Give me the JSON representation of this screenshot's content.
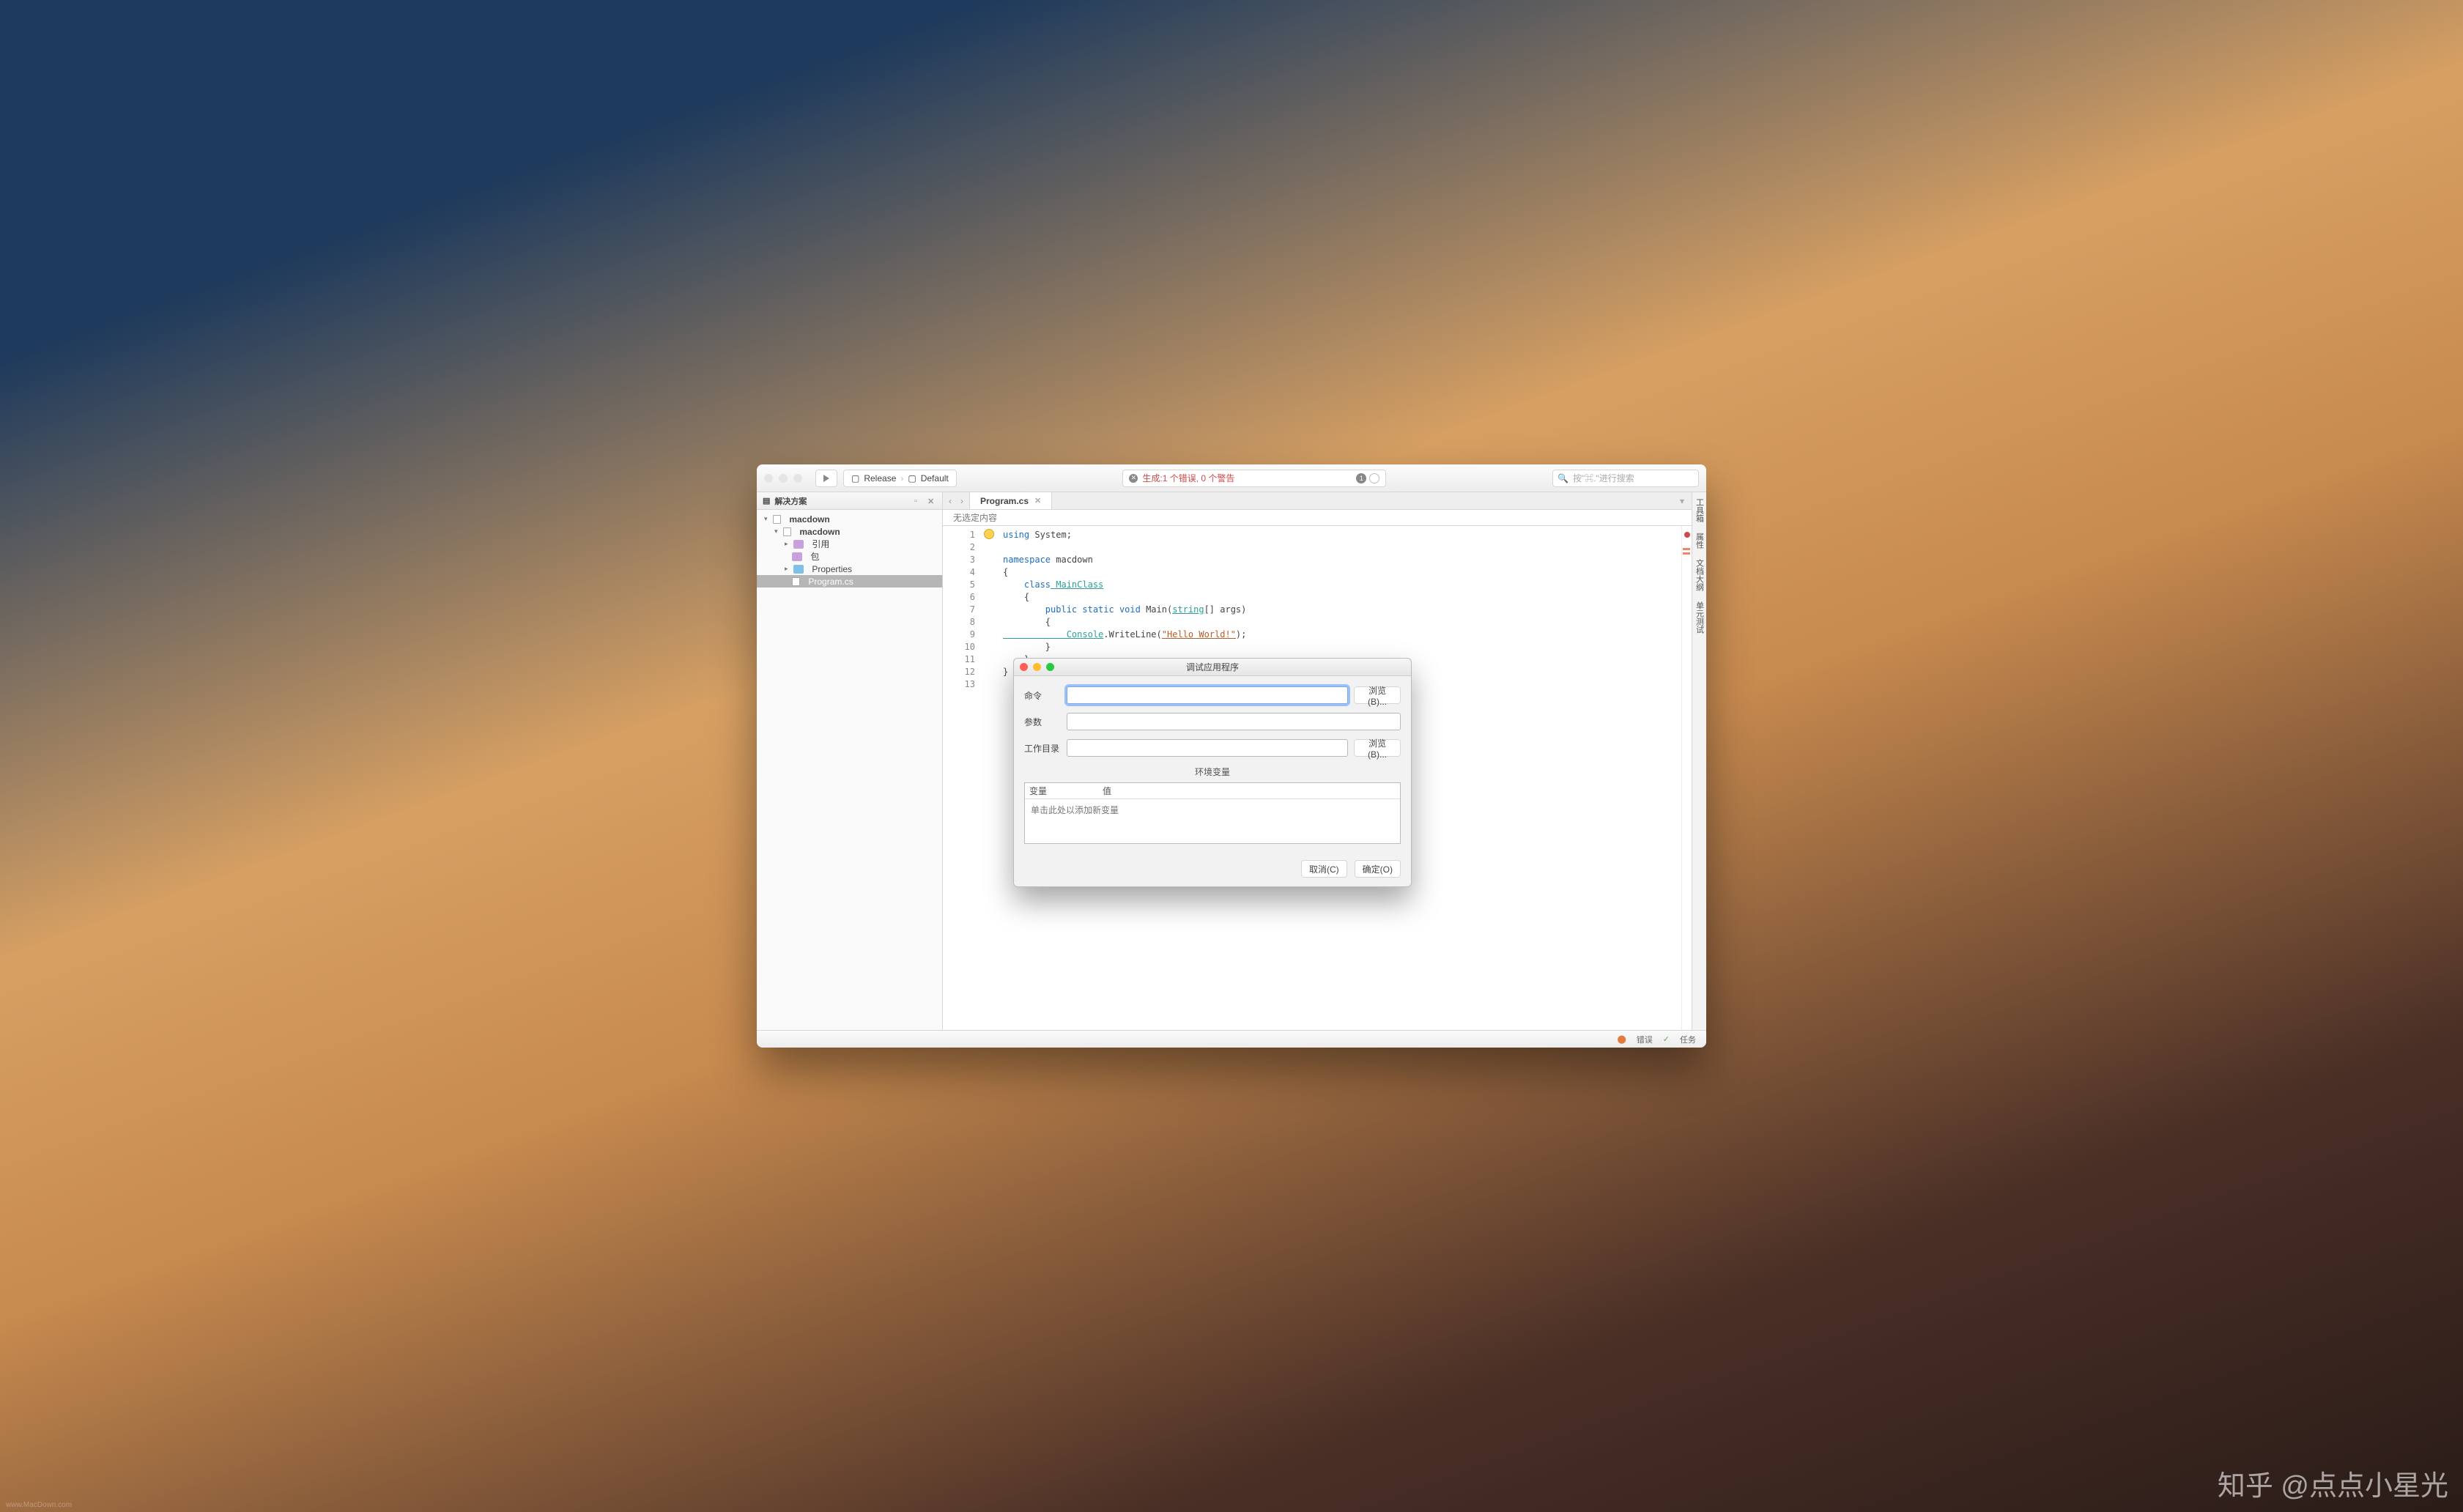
{
  "toolbar": {
    "config": "Release",
    "chevron": "›",
    "target": "Default",
    "search_placeholder": "按\"⌘.\"进行搜索"
  },
  "build": {
    "text": "生成:1 个错误, 0 个警告",
    "error_count": "1"
  },
  "sidebar": {
    "title": "解决方案",
    "sln": "macdown",
    "proj": "macdown",
    "refs": "引用",
    "pkgs": "包",
    "props": "Properties",
    "file": "Program.cs"
  },
  "editor": {
    "tab": "Program.cs",
    "breadcrumb": "无选定内容",
    "line_numbers": [
      "1",
      "2",
      "3",
      "4",
      "5",
      "6",
      "7",
      "8",
      "9",
      "10",
      "11",
      "12",
      "13"
    ]
  },
  "code": {
    "l1a": "using",
    "l1b": " System;",
    "l3a": "namespace",
    "l3b": " macdown",
    "l4": "{",
    "l5a": "    class",
    "l5b": " MainClass",
    "l6": "    {",
    "l7a": "        public",
    "l7b": " static",
    "l7c": " void",
    "l7d": " Main(",
    "l7e": "string",
    "l7f": "[] args)",
    "l8": "        {",
    "l9a": "            Console",
    "l9b": ".WriteLine(",
    "l9c": "\"Hello World!\"",
    "l9d": ");",
    "l10": "        }",
    "l11": "    }",
    "l12": "}"
  },
  "rhs": {
    "a": "工具箱",
    "b": "属性",
    "c": "文档大纲",
    "d": "单元测试"
  },
  "status": {
    "errors": "错误",
    "tasks": "任务"
  },
  "dialog": {
    "title": "调试应用程序",
    "cmd_label": "命令",
    "browse": "浏览(B)...",
    "args_label": "参数",
    "wd_label": "工作目录",
    "env_title": "环境变量",
    "var_col": "变量",
    "val_col": "值",
    "env_hint": "单击此处以添加新变量",
    "cancel": "取消(C)",
    "ok": "确定(O)"
  },
  "watermark": "知乎 @点点小星光",
  "footer": "www.MacDown.com"
}
